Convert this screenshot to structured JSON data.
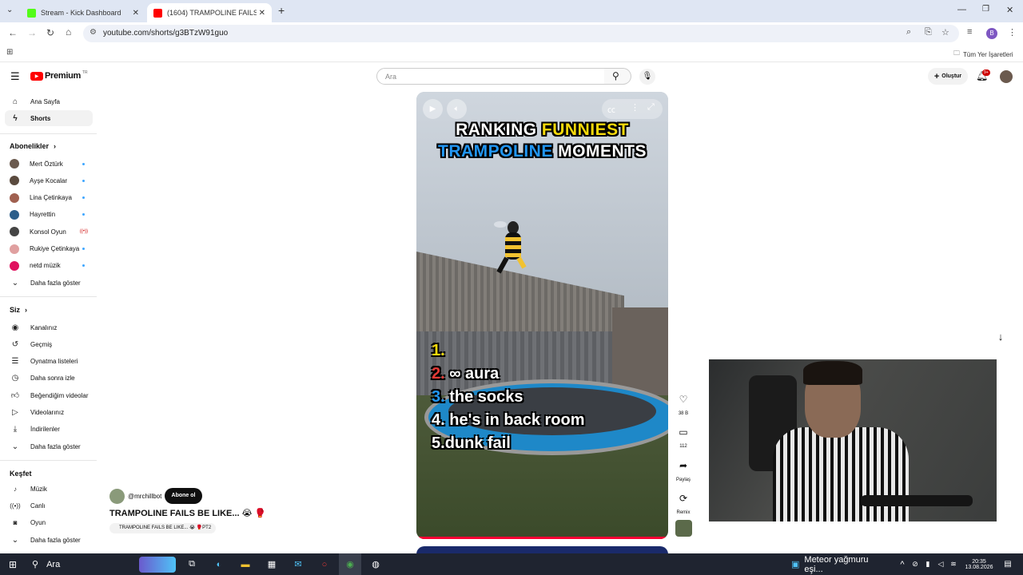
{
  "browser": {
    "tabs": [
      {
        "title": "Stream - Kick Dashboard",
        "active": false,
        "favicon_color": "#53fc18"
      },
      {
        "title": "(1604) TRAMPOLINE FAILS BE L",
        "active": true,
        "favicon_color": "#ff0000"
      }
    ],
    "url": "youtube.com/shorts/g3BTzW91guo",
    "bookmarks_label": "Tüm Yer İşaretleri",
    "profile_letter": "B"
  },
  "header": {
    "logo_text": "Premium",
    "logo_badge": "TR",
    "search_placeholder": "Ara",
    "create_label": "Oluştur",
    "notif_count": "9+"
  },
  "sidebar": {
    "main": [
      {
        "label": "Ana Sayfa",
        "icon": "home-icon"
      },
      {
        "label": "Shorts",
        "icon": "shorts-icon",
        "active": true
      }
    ],
    "subs_header": "Abonelikler",
    "subs": [
      {
        "label": "Mert Öztürk",
        "color": "#6b5a4e",
        "status": "dot"
      },
      {
        "label": "Ayşe Kocalar",
        "color": "#5a4a3e",
        "status": "dot"
      },
      {
        "label": "Lina Çetinkaya",
        "color": "#a06050",
        "status": "dot"
      },
      {
        "label": "Hayrettin",
        "color": "#2c5e8a",
        "status": "dot"
      },
      {
        "label": "Konsol Oyun",
        "color": "#444444",
        "status": "live"
      },
      {
        "label": "Rukiye Çetinkaya",
        "color": "#e0a0a0",
        "status": "dot"
      },
      {
        "label": "netd müzik",
        "color": "#e0115f",
        "status": "dot"
      }
    ],
    "subs_more": "Daha fazla göster",
    "you_header": "Siz",
    "you": [
      {
        "label": "Kanalınız",
        "icon": "channel-icon"
      },
      {
        "label": "Geçmiş",
        "icon": "history-icon"
      },
      {
        "label": "Oynatma listeleri",
        "icon": "playlist-icon"
      },
      {
        "label": "Daha sonra izle",
        "icon": "clock-icon"
      },
      {
        "label": "Beğendiğim videolar",
        "icon": "like-icon"
      },
      {
        "label": "Videolarınız",
        "icon": "video-icon"
      },
      {
        "label": "İndirilenler",
        "icon": "download-icon"
      }
    ],
    "you_more": "Daha fazla göster",
    "explore_header": "Keşfet",
    "explore": [
      {
        "label": "Müzik",
        "icon": "music-icon"
      },
      {
        "label": "Canlı",
        "icon": "live-icon"
      },
      {
        "label": "Oyun",
        "icon": "gaming-icon"
      }
    ],
    "explore_more": "Daha fazla göster"
  },
  "video": {
    "title_line1_a": "RANKING",
    "title_line1_b": "FUNNIEST",
    "title_line2_a": "TRAMPOLINE",
    "title_line2_b": "MOMENTS",
    "rankings": [
      {
        "num": "1.",
        "text": "",
        "color": "#f5d90a"
      },
      {
        "num": "2.",
        "text": " ∞ aura",
        "color": "#e53935"
      },
      {
        "num": "3.",
        "text": " the socks",
        "color": "#2196f3"
      },
      {
        "num": "4.",
        "text": " he's in back room",
        "color": "#ffffff"
      },
      {
        "num": "5.",
        "text": "dunk fail",
        "color": "#ffffff"
      }
    ]
  },
  "actions": {
    "likes": "38 B",
    "comments": "112",
    "share": "Paylaş",
    "remix": "Remix"
  },
  "channel": {
    "handle": "@mrchillbot",
    "subscribe": "Abone ol",
    "title": "TRAMPOLINE FAILS BE LIKE... 😭 🥊",
    "playlist": "TRAMPOLINE FAILS BE LIKE... 😭 🥊PT2"
  },
  "taskbar": {
    "search": "Ara",
    "weather": "Meteor yağmuru eşi...",
    "time": "20:35",
    "date": "13.08.2026"
  },
  "colors": {
    "yt_red": "#ff0000",
    "yellow": "#f5d90a",
    "blue": "#2196f3"
  }
}
